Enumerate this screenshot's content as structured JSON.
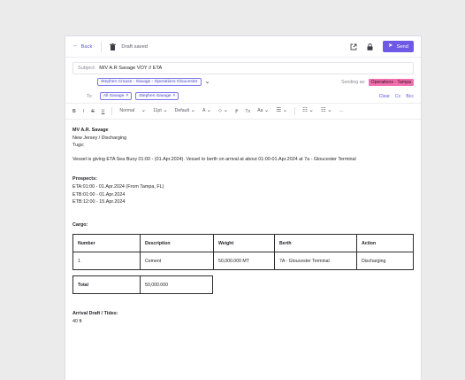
{
  "topbar": {
    "back_label": "Back",
    "draft_status": "Draft saved",
    "send_label": "Send"
  },
  "header": {
    "subject_label": "Subject:",
    "subject_value": "M/V A.R Savage VOY // ETA",
    "from_chip": "Stephen Crouse - Savage - Operations Gloucester",
    "sending_as_label": "Sending as:",
    "sending_as_value": "Operations - Tampa",
    "to_label": "To:",
    "recipients": [
      "All Savage",
      "Stephen Savage"
    ],
    "clear_label": "Clear",
    "cc_label": "Cc",
    "bcc_label": "Bcc"
  },
  "toolbar": {
    "bold": "B",
    "italic": "I",
    "strike": "S",
    "underline": "U",
    "style": "Normal",
    "size": "11pt",
    "font": "Default",
    "font_color": "A",
    "highlight": "◇",
    "format_paint": "⁋",
    "clear_format": "Tx",
    "case": "Aa",
    "more": "···"
  },
  "body": {
    "vessel_name": "MV A.R. Savage",
    "location": "New Jersey / Discharging",
    "tugs": "Tugs:",
    "eta_sentence": "Vessel is giving ETA Sea Buoy 01:00 - (01.Apr.2024). Vessel to berth on arrival at about 01:00-01.Apr.2024 at 7a - Gloucester Terminal",
    "prospects_title": "Prospects:",
    "prospects": [
      "ETA:01:00 - 01.Apr.2024 (From Tampa, FL)",
      "ETB:01:00 - 01.Apr.2024",
      "ETB:12:00 - 15.Apr.2024"
    ],
    "cargo_title": "Cargo:",
    "cargo_headers": [
      "Number",
      "Description",
      "Weight",
      "Berth",
      "Action"
    ],
    "cargo_row": [
      "1",
      "Cement",
      "50,000.000 MT",
      "7A - Gloucester Terminal",
      "Discharging"
    ],
    "total_label": "Total",
    "total_value": "50,000.000",
    "arrival_title": "Arrival Draft / Tides:",
    "arrival_value": "40 ft"
  },
  "colors": {
    "accent": "#6e59e6",
    "link": "#5b57d6",
    "badge": "#f36fae"
  },
  "icons": {
    "back": "arrow-left-icon",
    "trash": "trash-icon",
    "external": "external-link-icon",
    "lock": "lock-icon",
    "send": "send-icon"
  }
}
